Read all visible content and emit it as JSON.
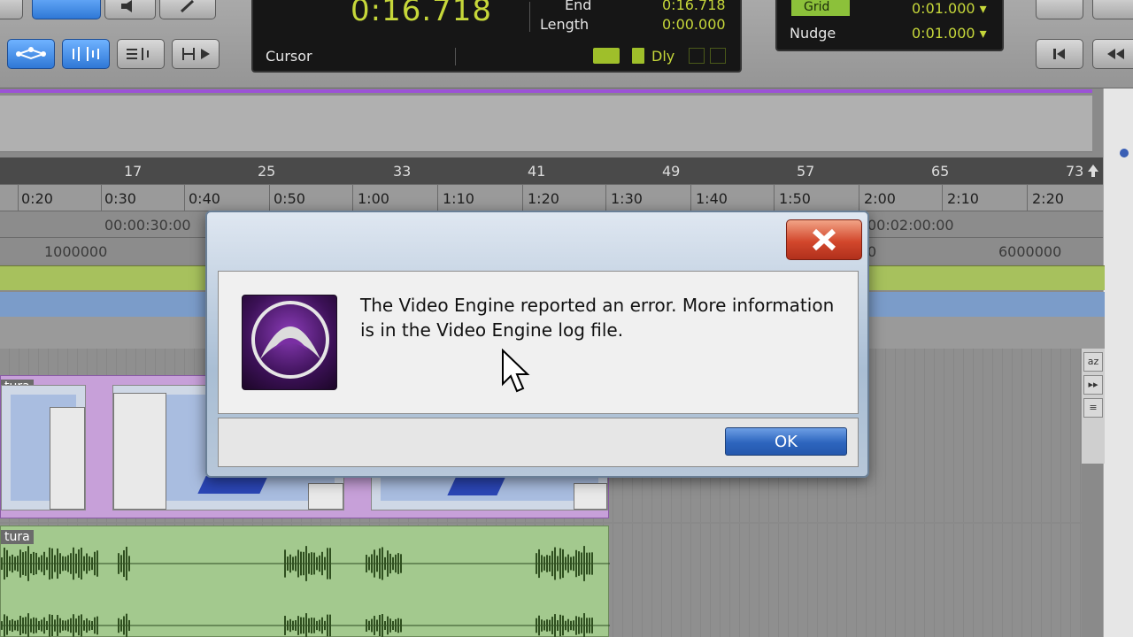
{
  "counter": {
    "main": "0:16.718",
    "cursor_label": "Cursor",
    "end_label": "End",
    "length_label": "Length",
    "end_value": "0:16.718",
    "length_value": "0:00.000",
    "dly_label": "Dly"
  },
  "grid_panel": {
    "grid_label": "Grid",
    "grid_value": "0:01.000 ▾",
    "nudge_label": "Nudge",
    "nudge_value": "0:01.000 ▾"
  },
  "rulers": {
    "bars": [
      "17",
      "25",
      "33",
      "41",
      "49",
      "57",
      "65",
      "73"
    ],
    "minsecs": [
      "0:20",
      "0:30",
      "0:40",
      "0:50",
      "1:00",
      "1:10",
      "1:20",
      "1:30",
      "1:40",
      "1:50",
      "2:00",
      "2:10",
      "2:20"
    ],
    "timecode": [
      "00:00:30:00",
      "00:02:00:00"
    ],
    "samples": [
      "1000000",
      "0",
      "6000000"
    ]
  },
  "tracks": {
    "video_clip_name": "tura",
    "audio_clip_name": "tura"
  },
  "dialog": {
    "message": "The Video Engine reported an error.  More information is in the Video Engine log file.",
    "ok_label": "OK"
  },
  "colors": {
    "counter_text": "#c6d73a",
    "dialog_close": "#d2472c",
    "ok_button": "#2d65be",
    "selection_line": "#9b52d6"
  }
}
